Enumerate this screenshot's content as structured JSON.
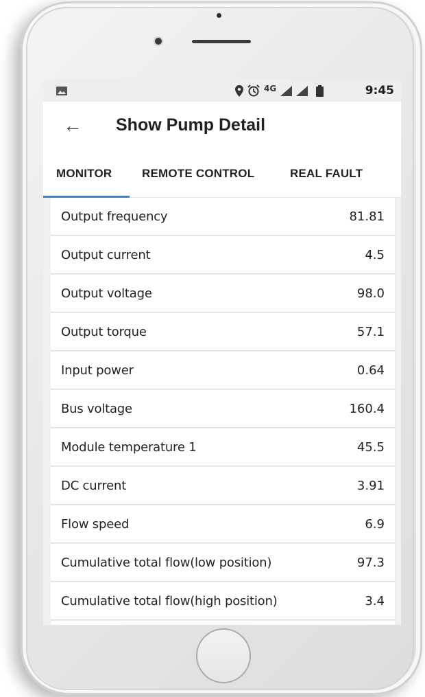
{
  "status_bar": {
    "time": "9:45",
    "network": "4G",
    "icons": [
      "image-icon",
      "location-pin-icon",
      "alarm-icon",
      "signal-icon",
      "battery-icon"
    ]
  },
  "app_bar": {
    "title": "Show Pump Detail",
    "back_icon": "arrow-left-icon"
  },
  "tabs": [
    {
      "label": "MONITOR",
      "active": true
    },
    {
      "label": "REMOTE CONTROL",
      "active": false
    },
    {
      "label": "REAL FAULT",
      "active": false
    }
  ],
  "accent_color": "#2f86d6",
  "rows": [
    {
      "label": "Output frequency",
      "value": "81.81"
    },
    {
      "label": "Output current",
      "value": "4.5"
    },
    {
      "label": "Output voltage",
      "value": "98.0"
    },
    {
      "label": "Output torque",
      "value": "57.1"
    },
    {
      "label": "Input power",
      "value": "0.64"
    },
    {
      "label": "Bus voltage",
      "value": "160.4"
    },
    {
      "label": "Module temperature 1",
      "value": "45.5"
    },
    {
      "label": "DC current",
      "value": "3.91"
    },
    {
      "label": "Flow speed",
      "value": "6.9"
    },
    {
      "label": "Cumulative total flow(low position)",
      "value": "97.3"
    },
    {
      "label": "Cumulative total flow(high position)",
      "value": "3.4"
    }
  ]
}
